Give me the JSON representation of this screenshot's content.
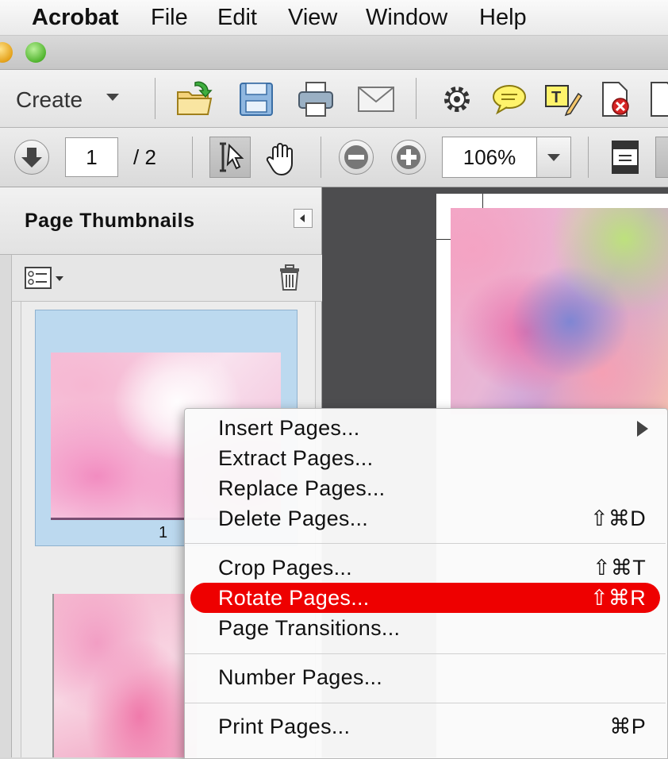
{
  "menubar": {
    "apple": "",
    "app": "Acrobat",
    "items": [
      {
        "label": "File"
      },
      {
        "label": "Edit"
      },
      {
        "label": "View"
      },
      {
        "label": "Window"
      },
      {
        "label": "Help"
      }
    ]
  },
  "toolbar": {
    "create_label": "Create",
    "icons": [
      "open-folder-icon",
      "save-icon",
      "print-icon",
      "email-icon",
      "settings-gear-icon",
      "comment-bubble-icon",
      "text-annotation-icon",
      "delete-page-icon",
      "page-icon"
    ]
  },
  "navigation": {
    "current_page": "1",
    "page_total": "/ 2",
    "zoom": "106%"
  },
  "panel": {
    "title": "Page Thumbnails",
    "thumbnails": [
      {
        "label": "1"
      },
      {
        "label": ""
      }
    ]
  },
  "context_menu": {
    "items": [
      {
        "label": "Insert Pages...",
        "shortcut": "",
        "submenu": true
      },
      {
        "label": "Extract Pages...",
        "shortcut": ""
      },
      {
        "label": "Replace Pages...",
        "shortcut": ""
      },
      {
        "label": "Delete Pages...",
        "shortcut": "⇧⌘D"
      },
      {
        "label": "Crop Pages...",
        "shortcut": "⇧⌘T"
      },
      {
        "label": "Rotate Pages...",
        "shortcut": "⇧⌘R",
        "highlighted": true
      },
      {
        "label": "Page Transitions...",
        "shortcut": ""
      },
      {
        "label": "Number Pages...",
        "shortcut": ""
      },
      {
        "label": "Print Pages...",
        "shortcut": "⌘P"
      }
    ]
  },
  "colors": {
    "highlight": "#ee0000",
    "selection": "#bcd9ef"
  }
}
